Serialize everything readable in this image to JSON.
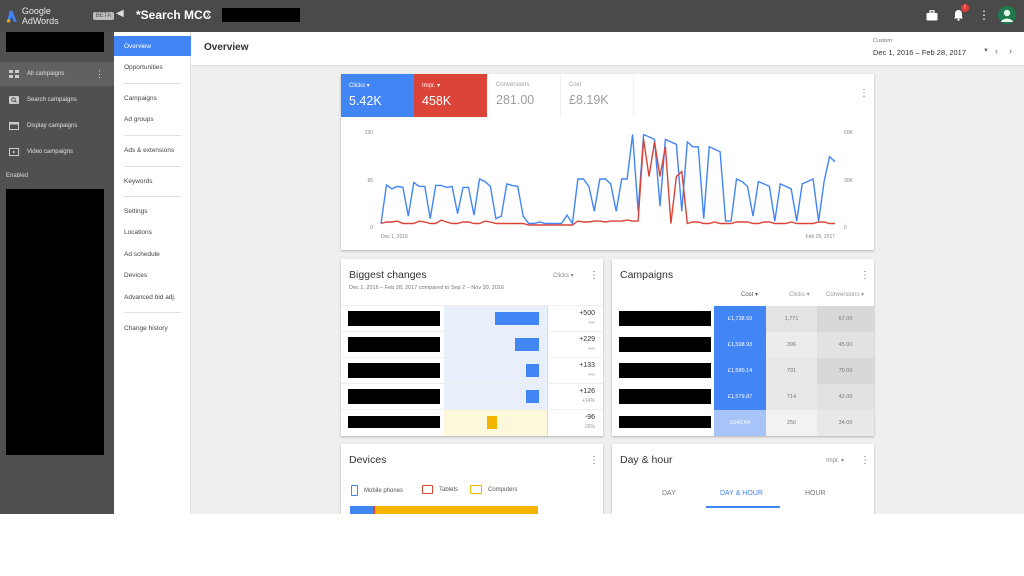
{
  "topbar": {
    "brand_name": "Google AdWords",
    "beta_badge": "BETA",
    "account_name": "*Search MCC",
    "icons": [
      "adwords-logo-icon",
      "collapse-icon",
      "chevron-right-icon",
      "briefcase-icon",
      "bell-icon",
      "more-vert-icon",
      "account-icon"
    ],
    "notification_count": "!"
  },
  "sidebar": {
    "items": [
      {
        "label": "All campaigns",
        "icon": "grid-icon"
      },
      {
        "label": "Search campaigns",
        "icon": "search-icon"
      },
      {
        "label": "Display campaigns",
        "icon": "display-icon"
      },
      {
        "label": "Video campaigns",
        "icon": "video-icon"
      }
    ],
    "enabled_label": "Enabled"
  },
  "pagenav": {
    "items": [
      {
        "label": "Overview"
      },
      {
        "label": "Opportunities"
      },
      {
        "label": "Campaigns"
      },
      {
        "label": "Ad groups"
      },
      {
        "label": "Ads & extensions"
      },
      {
        "label": "Keywords"
      },
      {
        "label": "Settings"
      },
      {
        "label": "Locations"
      },
      {
        "label": "Ad schedule"
      },
      {
        "label": "Devices"
      },
      {
        "label": "Advanced bid adj."
      },
      {
        "label": "Change history"
      }
    ]
  },
  "header": {
    "title": "Overview",
    "date_caption": "Custom",
    "date_range": "Dec 1, 2016 – Feb 28, 2017"
  },
  "overview": {
    "metrics": [
      {
        "label": "Clicks",
        "value": "5.42K"
      },
      {
        "label": "Impr.",
        "value": "458K"
      },
      {
        "label": "Conversions",
        "value": "281.00"
      },
      {
        "label": "Cost",
        "value": "£8.19K"
      }
    ],
    "colors": {
      "clicks": "#4285f4",
      "impr": "#db4437"
    }
  },
  "chart_data": {
    "type": "line",
    "x_start_label": "Dec 1, 2016",
    "x_end_label": "Feb 28, 2017",
    "y_left_ticks": [
      "0",
      "95",
      "190"
    ],
    "y_right_ticks": [
      "0",
      "30K",
      "60K"
    ],
    "series": [
      {
        "name": "Clicks",
        "color": "#4285f4",
        "values": [
          5,
          83,
          75,
          80,
          78,
          20,
          88,
          80,
          80,
          15,
          82,
          82,
          78,
          80,
          25,
          78,
          78,
          22,
          95,
          90,
          80,
          15,
          20,
          85,
          82,
          80,
          20,
          5,
          5,
          8,
          5,
          5,
          5,
          5,
          22,
          5,
          95,
          95,
          80,
          30,
          95,
          95,
          85,
          30,
          95,
          95,
          185,
          30,
          185,
          180,
          175,
          40,
          175,
          170,
          165,
          30,
          170,
          160,
          160,
          15,
          160,
          155,
          150,
          10,
          10,
          95,
          90,
          80,
          20,
          90,
          85,
          80,
          10,
          85,
          80,
          75,
          10,
          85,
          90,
          95,
          10,
          90,
          140,
          130
        ]
      },
      {
        "name": "Impr.",
        "color": "#db4437",
        "values": [
          5,
          8,
          8,
          10,
          5,
          5,
          5,
          10,
          8,
          5,
          5,
          12,
          8,
          5,
          5,
          8,
          8,
          5,
          5,
          10,
          8,
          5,
          5,
          5,
          5,
          5,
          5,
          2,
          2,
          2,
          2,
          2,
          2,
          2,
          2,
          2,
          10,
          8,
          8,
          10,
          10,
          8,
          10,
          10,
          10,
          12,
          10,
          10,
          175,
          100,
          170,
          100,
          160,
          5,
          100,
          110,
          5,
          8,
          8,
          5,
          5,
          8,
          5,
          5,
          5,
          8,
          8,
          8,
          5,
          5,
          8,
          8,
          5,
          5,
          5,
          8,
          5,
          5,
          5,
          5,
          8,
          8,
          5,
          5
        ]
      }
    ]
  },
  "biggest_changes": {
    "title": "Biggest changes",
    "subtitle": "Dec 1, 2016 – Feb 28, 2017 compared to Sep 2 – Nov 30, 2016",
    "metric_select": "Clicks",
    "rows": [
      {
        "value": "+500",
        "sub": "+∞",
        "bar_fraction": 1.0,
        "positive": true
      },
      {
        "value": "+229",
        "sub": "+∞",
        "bar_fraction": 0.55,
        "positive": true
      },
      {
        "value": "+133",
        "sub": "+∞",
        "bar_fraction": 0.3,
        "positive": true
      },
      {
        "value": "+126",
        "sub": "+14%",
        "bar_fraction": 0.3,
        "positive": true
      },
      {
        "value": "-96",
        "sub": "-26%",
        "bar_fraction": 0.22,
        "positive": false
      }
    ]
  },
  "campaigns": {
    "title": "Campaigns",
    "columns": {
      "cost": "Cost",
      "clicks": "Clicks",
      "conversions": "Conversions"
    },
    "rows": [
      {
        "cost": "£1,738.59",
        "clicks": "1,771",
        "conversions": "67.00"
      },
      {
        "cost": "£1,598.93",
        "clicks": "396",
        "conversions": "45.00"
      },
      {
        "cost": "£1,580.14",
        "clicks": "791",
        "conversions": "70.00"
      },
      {
        "cost": "£1,579.87",
        "clicks": "714",
        "conversions": "42.00"
      },
      {
        "cost": "£540.64",
        "clicks": "250",
        "conversions": "34.00"
      }
    ]
  },
  "devices": {
    "title": "Devices",
    "legend": [
      {
        "label": "Mobile phones",
        "color": "#4285f4"
      },
      {
        "label": "Tablets",
        "color": "#db4437"
      },
      {
        "label": "Computers",
        "color": "#f4b400"
      }
    ]
  },
  "day_hour": {
    "title": "Day & hour",
    "metric_select": "Impr.",
    "tabs": [
      "DAY",
      "DAY & HOUR",
      "HOUR"
    ]
  }
}
